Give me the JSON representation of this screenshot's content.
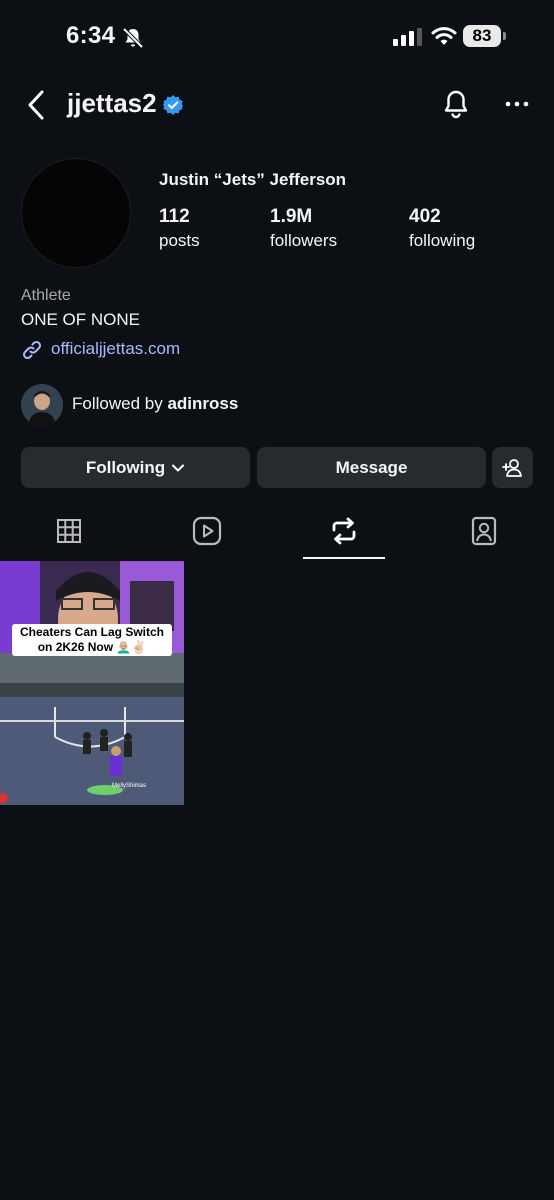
{
  "status_bar": {
    "time": "6:34",
    "battery": "83"
  },
  "header": {
    "username": "jjettas2"
  },
  "profile": {
    "full_name": "Justin “Jets” Jefferson",
    "stats": [
      {
        "value": "112",
        "label": "posts"
      },
      {
        "value": "1.9M",
        "label": "followers"
      },
      {
        "value": "402",
        "label": "following"
      }
    ],
    "category": "Athlete",
    "bio": "ONE OF NONE",
    "link": "officialjjettas.com",
    "followed_by_prefix": "Followed by ",
    "followed_by_user": "adinross"
  },
  "actions": {
    "following_label": "Following",
    "message_label": "Message"
  },
  "tabs": [
    {
      "icon": "grid-icon",
      "active": false
    },
    {
      "icon": "reels-icon",
      "active": false
    },
    {
      "icon": "reposts-icon",
      "active": true
    },
    {
      "icon": "tagged-icon",
      "active": false
    }
  ],
  "posts": [
    {
      "caption": "Cheaters Can Lag Switch on 2K26 Now 👨🏼‍🦲✌🏻",
      "overlay_name": "MellyShimas"
    }
  ],
  "colors": {
    "background": "#0c1014",
    "button": "#272b30",
    "link": "#a9b8ff",
    "verified": "#3897f0"
  }
}
